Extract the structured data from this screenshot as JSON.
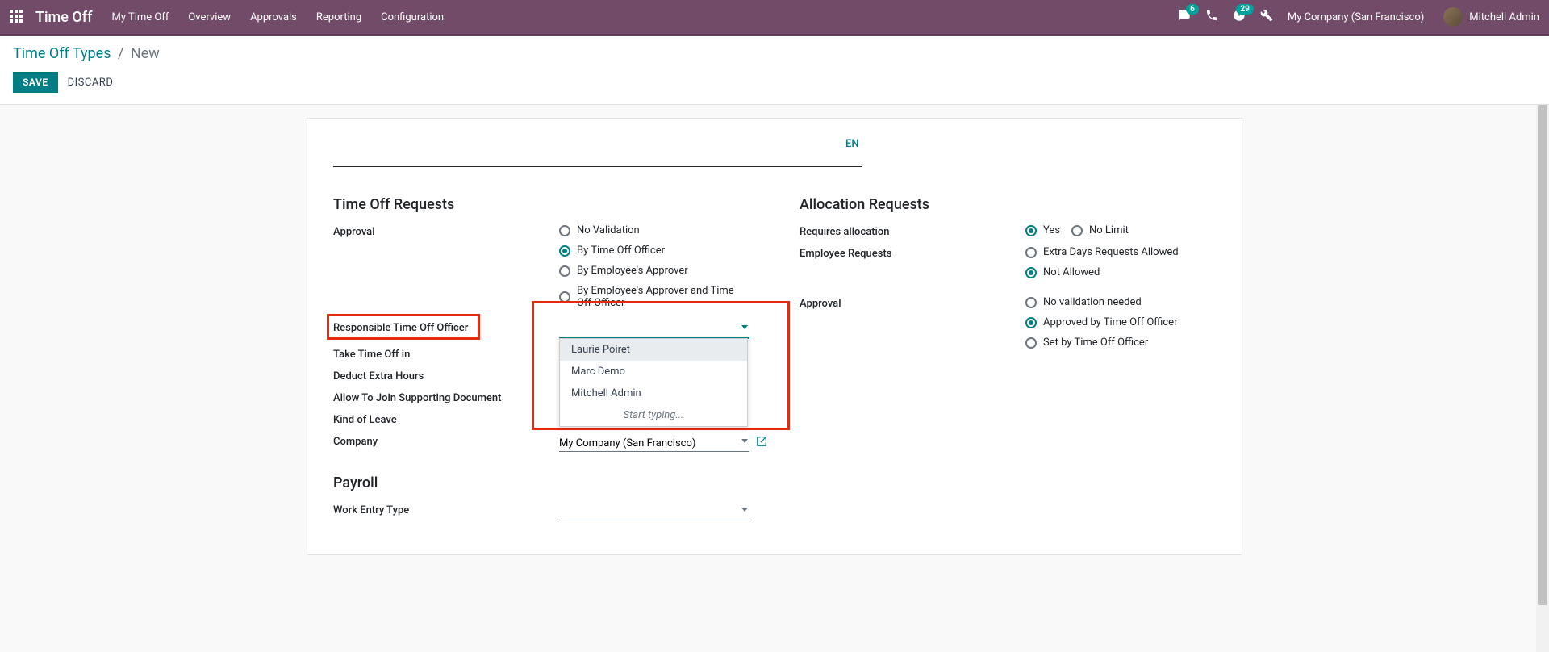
{
  "topnav": {
    "brand": "Time Off",
    "menu": [
      "My Time Off",
      "Overview",
      "Approvals",
      "Reporting",
      "Configuration"
    ],
    "messages_badge": "6",
    "activities_badge": "29",
    "company": "My Company (San Francisco)",
    "user": "Mitchell Admin"
  },
  "breadcrumb": {
    "root": "Time Off Types",
    "current": "New"
  },
  "actions": {
    "save": "SAVE",
    "discard": "DISCARD"
  },
  "lang": "EN",
  "left": {
    "section": "Time Off Requests",
    "approval_label": "Approval",
    "approval_options": [
      "No Validation",
      "By Time Off Officer",
      "By Employee's Approver",
      "By Employee's Approver and Time Off Officer"
    ],
    "responsible_label": "Responsible Time Off Officer",
    "take_label": "Take Time Off in",
    "deduct_label": "Deduct Extra Hours",
    "allow_doc_label": "Allow To Join Supporting Document",
    "kind_label": "Kind of Leave",
    "company_label": "Company",
    "company_value": "My Company (San Francisco)",
    "dropdown": {
      "options": [
        "Laurie Poiret",
        "Marc Demo",
        "Mitchell Admin"
      ],
      "hint": "Start typing..."
    },
    "payroll_section": "Payroll",
    "work_entry_label": "Work Entry Type"
  },
  "right": {
    "section": "Allocation Requests",
    "requires_label": "Requires allocation",
    "requires_options": [
      "Yes",
      "No Limit"
    ],
    "emp_req_label": "Employee Requests",
    "emp_req_options": [
      "Extra Days Requests Allowed",
      "Not Allowed"
    ],
    "approval_label": "Approval",
    "approval_options": [
      "No validation needed",
      "Approved by Time Off Officer",
      "Set by Time Off Officer"
    ]
  }
}
